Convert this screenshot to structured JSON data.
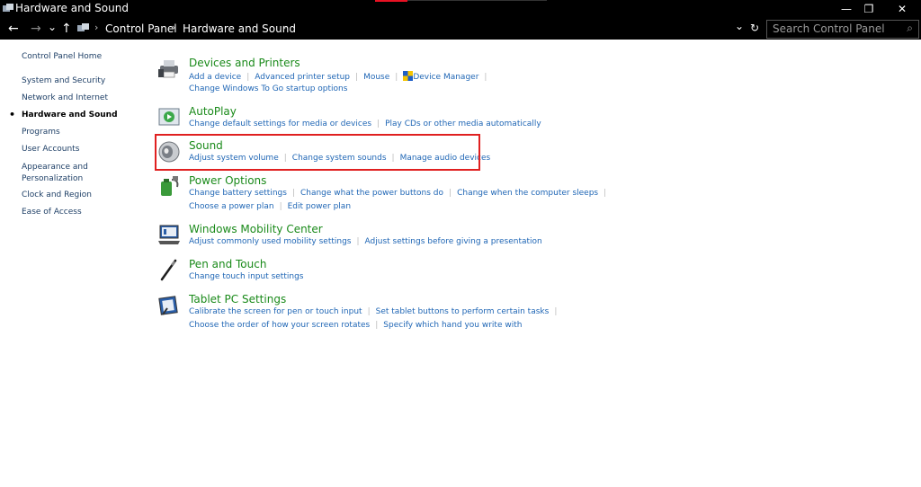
{
  "window": {
    "title": "Hardware and Sound",
    "minimize": "—",
    "restore": "❐",
    "close": "✕"
  },
  "nav": {
    "back": "←",
    "forward": "→",
    "recent": "⌄",
    "up": "↑",
    "breadcrumbs": [
      "Control Panel",
      "Hardware and Sound"
    ],
    "separator": "›",
    "dropdown": "⌄",
    "refresh": "↻",
    "search_placeholder": "Search Control Panel",
    "search_icon": "⌕"
  },
  "sidebar": {
    "items": [
      {
        "label": "Control Panel Home",
        "active": false
      },
      {
        "label": "System and Security",
        "active": false
      },
      {
        "label": "Network and Internet",
        "active": false
      },
      {
        "label": "Hardware and Sound",
        "active": true
      },
      {
        "label": "Programs",
        "active": false
      },
      {
        "label": "User Accounts",
        "active": false
      },
      {
        "label": "Appearance and",
        "active": false
      },
      {
        "label": "Personalization",
        "active": false
      },
      {
        "label": "Clock and Region",
        "active": false
      },
      {
        "label": "Ease of Access",
        "active": false
      }
    ],
    "bullet": "•"
  },
  "categories": [
    {
      "title": "Devices and Printers",
      "icon": "printer-icon",
      "lines": [
        [
          "Add a device",
          "Advanced printer setup",
          "Mouse",
          "Device Manager"
        ],
        [
          "Change Windows To Go startup options"
        ]
      ]
    },
    {
      "title": "AutoPlay",
      "icon": "autoplay-icon",
      "lines": [
        [
          "Change default settings for media or devices",
          "Play CDs or other media automatically"
        ]
      ]
    },
    {
      "title": "Sound",
      "icon": "speaker-icon",
      "lines": [
        [
          "Adjust system volume",
          "Change system sounds",
          "Manage audio devices"
        ]
      ]
    },
    {
      "title": "Power Options",
      "icon": "power-options-icon",
      "lines": [
        [
          "Change battery settings",
          "Change what the power buttons do",
          "Change when the computer sleeps"
        ],
        [
          "Choose a power plan",
          "Edit power plan"
        ]
      ]
    },
    {
      "title": "Windows Mobility Center",
      "icon": "mobility-center-icon",
      "lines": [
        [
          "Adjust commonly used mobility settings",
          "Adjust settings before giving a presentation"
        ]
      ]
    },
    {
      "title": "Pen and Touch",
      "icon": "pen-icon",
      "lines": [
        [
          "Change touch input settings"
        ]
      ]
    },
    {
      "title": "Tablet PC Settings",
      "icon": "tablet-icon",
      "lines": [
        [
          "Calibrate the screen for pen or touch input",
          "Set tablet buttons to perform certain tasks"
        ],
        [
          "Choose the order of how your screen rotates",
          "Specify which hand you write with"
        ]
      ]
    }
  ],
  "colors": {
    "link": "#1f66b5",
    "category_title": "#1a8a1a",
    "highlight": "#e02020"
  }
}
